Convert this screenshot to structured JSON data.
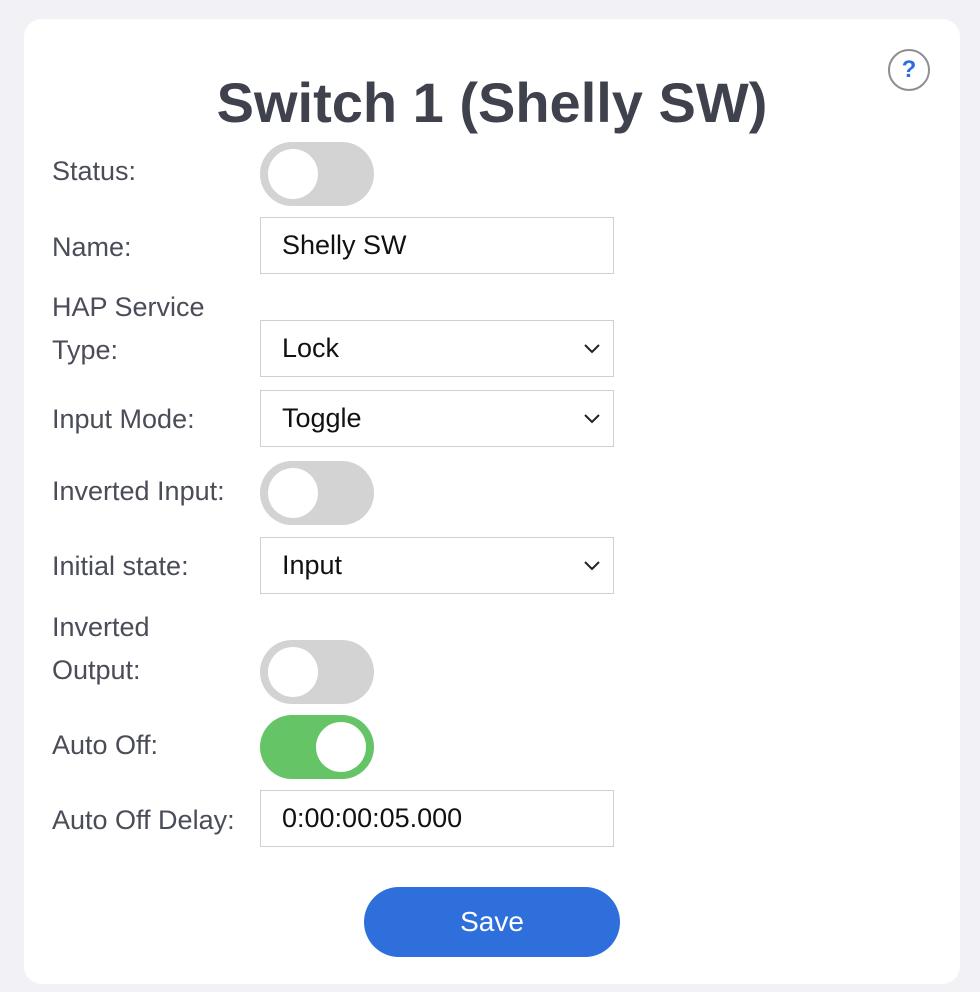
{
  "page": {
    "title": "Switch 1 (Shelly SW)",
    "help_label": "?"
  },
  "form": {
    "status": {
      "label": "Status:",
      "on": false
    },
    "name": {
      "label": "Name:",
      "value": "Shelly SW"
    },
    "hap_service_type": {
      "label_line1": "HAP Service",
      "label_line2": "Type:",
      "value": "Lock"
    },
    "input_mode": {
      "label": "Input Mode:",
      "value": "Toggle"
    },
    "inverted_input": {
      "label": "Inverted Input:",
      "on": false
    },
    "initial_state": {
      "label": "Initial state:",
      "value": "Input"
    },
    "inverted_output": {
      "label_line1": "Inverted",
      "label_line2": "Output:",
      "on": false
    },
    "auto_off": {
      "label": "Auto Off:",
      "on": true
    },
    "auto_off_delay": {
      "label": "Auto Off Delay:",
      "value": "0:00:00:05.000"
    }
  },
  "actions": {
    "save_label": "Save"
  },
  "colors": {
    "toggle_on": "#64c466",
    "toggle_off": "#d3d3d3",
    "accent": "#2e6fdc",
    "title": "#3f424d",
    "background": "#f2f1f6"
  },
  "icons": {
    "help": "question-circle-icon",
    "select": "chevron-down-icon"
  }
}
